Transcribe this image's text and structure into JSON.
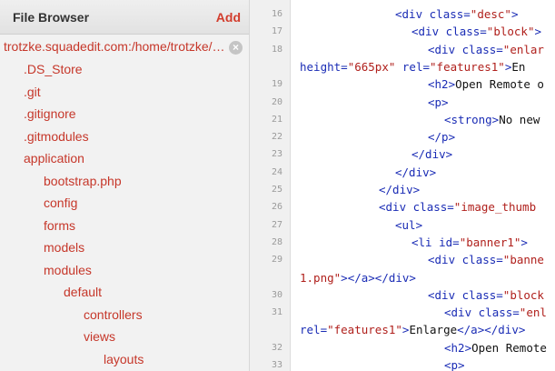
{
  "sidebar": {
    "title": "File Browser",
    "add_label": "Add",
    "root_path": "trotzke.squadedit.com:/home/trotzke/…",
    "close_glyph": "×",
    "items": [
      {
        "label": ".DS_Store",
        "depth": 1
      },
      {
        "label": ".git",
        "depth": 1
      },
      {
        "label": ".gitignore",
        "depth": 1
      },
      {
        "label": ".gitmodules",
        "depth": 1
      },
      {
        "label": "application",
        "depth": 1
      },
      {
        "label": "bootstrap.php",
        "depth": 2
      },
      {
        "label": "config",
        "depth": 2
      },
      {
        "label": "forms",
        "depth": 2
      },
      {
        "label": "models",
        "depth": 2
      },
      {
        "label": "modules",
        "depth": 2
      },
      {
        "label": "default",
        "depth": 3
      },
      {
        "label": "controllers",
        "depth": 4
      },
      {
        "label": "views",
        "depth": 4
      },
      {
        "label": "layouts",
        "depth": 5
      }
    ],
    "link_color": "#c6372a"
  },
  "editor": {
    "tag_color": "#1a2cb5",
    "string_color": "#b0201c",
    "lines": [
      {
        "num": "16",
        "parts": [
          [
            "t",
            "<div "
          ],
          [
            "a",
            "class="
          ],
          [
            "s",
            "\"desc\""
          ],
          [
            "t",
            ">"
          ]
        ],
        "indent": 104
      },
      {
        "num": "17",
        "parts": [
          [
            "t",
            "<div "
          ],
          [
            "a",
            "class="
          ],
          [
            "s",
            "\"block\""
          ],
          [
            "t",
            ">"
          ]
        ],
        "indent": 122
      },
      {
        "num": "18",
        "parts": [
          [
            "t",
            "<div "
          ],
          [
            "a",
            "class="
          ],
          [
            "s",
            "\"enlar"
          ]
        ],
        "indent": 140
      },
      {
        "num": "",
        "parts": [
          [
            "a",
            "height="
          ],
          [
            "s",
            "\"665px\""
          ],
          [
            "p",
            " "
          ],
          [
            "a",
            "rel="
          ],
          [
            "s",
            "\"features1\""
          ],
          [
            "t",
            ">"
          ],
          [
            "p",
            "En"
          ]
        ],
        "indent": 0
      },
      {
        "num": "19",
        "parts": [
          [
            "t",
            "<h2>"
          ],
          [
            "p",
            "Open Remote o"
          ]
        ],
        "indent": 140
      },
      {
        "num": "20",
        "parts": [
          [
            "t",
            "<p>"
          ]
        ],
        "indent": 140
      },
      {
        "num": "21",
        "parts": [
          [
            "t",
            "<strong>"
          ],
          [
            "p",
            "No new "
          ]
        ],
        "indent": 158
      },
      {
        "num": "22",
        "parts": [
          [
            "t",
            "</p>"
          ]
        ],
        "indent": 140
      },
      {
        "num": "23",
        "parts": [
          [
            "t",
            "</div>"
          ]
        ],
        "indent": 122
      },
      {
        "num": "24",
        "parts": [
          [
            "t",
            "</div>"
          ]
        ],
        "indent": 104
      },
      {
        "num": "25",
        "parts": [
          [
            "t",
            "</div>"
          ]
        ],
        "indent": 86
      },
      {
        "num": "26",
        "parts": [
          [
            "t",
            "<div "
          ],
          [
            "a",
            "class="
          ],
          [
            "s",
            "\"image_thumb"
          ]
        ],
        "indent": 86
      },
      {
        "num": "27",
        "parts": [
          [
            "t",
            "<ul>"
          ]
        ],
        "indent": 104
      },
      {
        "num": "28",
        "parts": [
          [
            "t",
            "<li "
          ],
          [
            "a",
            "id="
          ],
          [
            "s",
            "\"banner1\""
          ],
          [
            "t",
            ">"
          ]
        ],
        "indent": 122
      },
      {
        "num": "29",
        "parts": [
          [
            "t",
            "<div "
          ],
          [
            "a",
            "class="
          ],
          [
            "s",
            "\"banne"
          ]
        ],
        "indent": 140
      },
      {
        "num": "",
        "parts": [
          [
            "s",
            "1.png\""
          ],
          [
            "t",
            ">"
          ],
          [
            "t",
            "</a>"
          ],
          [
            "t",
            "</div>"
          ]
        ],
        "indent": 0
      },
      {
        "num": "30",
        "parts": [
          [
            "t",
            "<div "
          ],
          [
            "a",
            "class="
          ],
          [
            "s",
            "\"block"
          ]
        ],
        "indent": 140
      },
      {
        "num": "31",
        "parts": [
          [
            "t",
            "<div "
          ],
          [
            "a",
            "class="
          ],
          [
            "s",
            "\"enl"
          ]
        ],
        "indent": 158
      },
      {
        "num": "",
        "parts": [
          [
            "a",
            "rel="
          ],
          [
            "s",
            "\"features1\""
          ],
          [
            "t",
            ">"
          ],
          [
            "p",
            "Enlarge"
          ],
          [
            "t",
            "</a>"
          ],
          [
            "t",
            "</div>"
          ]
        ],
        "indent": 0
      },
      {
        "num": "32",
        "parts": [
          [
            "t",
            "<h2>"
          ],
          [
            "p",
            "Open Remote"
          ]
        ],
        "indent": 158
      },
      {
        "num": "33",
        "parts": [
          [
            "t",
            "<p>"
          ]
        ],
        "indent": 158
      }
    ]
  }
}
